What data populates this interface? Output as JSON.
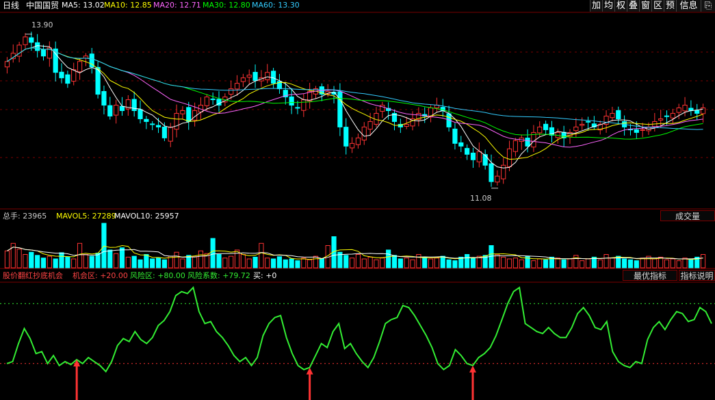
{
  "header": {
    "period": "日线",
    "stock_name": "中国国贸",
    "ma": [
      {
        "label": "MA5: 13.02",
        "color": "#ffffff"
      },
      {
        "label": "MA10: 12.85",
        "color": "#ffff00"
      },
      {
        "label": "MA20: 12.71",
        "color": "#ff66ff"
      },
      {
        "label": "MA30: 12.80",
        "color": "#00ff00"
      },
      {
        "label": "MA60: 13.30",
        "color": "#33ccff"
      }
    ]
  },
  "toolbar": [
    "加",
    "均",
    "权",
    "叠",
    "窗",
    "区",
    "预",
    "信息"
  ],
  "volume_header": {
    "total": "总手: 23965",
    "mavol5": "MAVOL5: 27289",
    "mavol10": "MAVOL10: 25957",
    "button": "成交量"
  },
  "indicator_header": {
    "name": "股价翻红抄底机会",
    "chance": "机会区: +20.00",
    "risk": "风险区: +80.00",
    "coef": "风险系数: +79.72",
    "buy": "买: +0",
    "button_best": "最优指标",
    "button_help": "指标说明"
  },
  "price_labels": {
    "high": "13.90",
    "low": "11.08"
  },
  "colors": {
    "up": "#ff3333",
    "down": "#00ffff",
    "grid": "#7a0000",
    "osc": "#33ee33",
    "signal": "#ff3333"
  },
  "chart_data": [
    {
      "type": "candlestick",
      "title": "日线 中国国贸",
      "ylim": [
        10.7,
        14.3
      ],
      "annotations": [
        {
          "label": "13.90",
          "value": 13.9
        },
        {
          "label": "11.08",
          "value": 11.08
        }
      ],
      "series": [
        {
          "name": "MA5",
          "values": [
            13.02
          ]
        },
        {
          "name": "MA10",
          "values": [
            12.85
          ]
        },
        {
          "name": "MA20",
          "values": [
            12.71
          ]
        },
        {
          "name": "MA30",
          "values": [
            12.8
          ]
        },
        {
          "name": "MA60",
          "values": [
            13.3
          ]
        }
      ],
      "closes": [
        13.4,
        13.55,
        13.7,
        13.85,
        13.75,
        13.6,
        13.5,
        13.65,
        13.2,
        13.1,
        13.0,
        13.25,
        13.4,
        13.5,
        13.3,
        12.8,
        12.6,
        12.4,
        12.6,
        12.5,
        12.7,
        12.5,
        12.35,
        12.3,
        12.25,
        12.2,
        12.0,
        12.2,
        12.45,
        12.5,
        12.3,
        12.5,
        12.6,
        12.75,
        12.7,
        12.6,
        12.75,
        12.9,
        13.0,
        13.1,
        13.15,
        13.05,
        13.1,
        13.2,
        13.0,
        12.9,
        12.75,
        12.6,
        12.55,
        12.7,
        12.85,
        12.9,
        12.8,
        12.85,
        12.8,
        12.2,
        11.85,
        11.9,
        12.0,
        12.2,
        12.3,
        12.45,
        12.6,
        12.5,
        12.3,
        12.2,
        12.25,
        12.35,
        12.45,
        12.4,
        12.55,
        12.6,
        12.5,
        12.2,
        11.9,
        11.85,
        11.7,
        11.6,
        11.75,
        11.5,
        11.2,
        11.3,
        11.5,
        11.8,
        11.95,
        12.0,
        11.85,
        12.1,
        12.2,
        12.15,
        12.05,
        12.1,
        12.0,
        12.1,
        12.2,
        12.25,
        12.3,
        12.2,
        12.25,
        12.4,
        12.45,
        12.35,
        12.2,
        12.15,
        12.1,
        12.15,
        12.2,
        12.3,
        12.35,
        12.4,
        12.45,
        12.55,
        12.6,
        12.5,
        12.45,
        12.55
      ]
    },
    {
      "type": "bar",
      "title": "总手",
      "series": [
        {
          "name": "MAVOL5",
          "values": [
            27289
          ]
        },
        {
          "name": "MAVOL10",
          "values": [
            25957
          ]
        }
      ],
      "values": [
        0.38,
        0.55,
        0.42,
        0.3,
        0.35,
        0.28,
        0.22,
        0.26,
        0.2,
        0.34,
        0.24,
        0.2,
        0.55,
        0.3,
        0.26,
        0.33,
        1.0,
        0.4,
        0.32,
        0.45,
        0.24,
        0.26,
        0.18,
        0.3,
        0.2,
        0.22,
        0.18,
        0.26,
        0.35,
        0.2,
        0.28,
        0.25,
        0.38,
        0.32,
        0.66,
        0.3,
        0.22,
        0.26,
        0.4,
        0.3,
        0.2,
        0.24,
        0.55,
        0.22,
        0.2,
        0.25,
        0.18,
        0.2,
        0.16,
        0.22,
        0.18,
        0.26,
        0.2,
        0.5,
        0.7,
        0.35,
        0.28,
        0.22,
        0.3,
        0.2,
        0.24,
        0.18,
        0.22,
        0.4,
        0.28,
        0.2,
        0.22,
        0.18,
        0.3,
        0.24,
        0.2,
        0.22,
        0.26,
        0.18,
        0.16,
        0.24,
        0.3,
        0.22,
        0.26,
        0.28,
        0.5,
        0.3,
        0.24,
        0.2,
        0.22,
        0.18,
        0.26,
        0.16,
        0.2,
        0.18,
        0.24,
        0.22,
        0.18,
        0.2,
        0.28,
        0.16,
        0.2,
        0.24,
        0.18,
        0.3,
        0.22,
        0.26,
        0.2,
        0.18,
        0.16,
        0.22,
        0.26,
        0.2,
        0.24,
        0.18,
        0.2,
        0.16,
        0.22,
        0.18,
        0.24,
        0.3
      ]
    },
    {
      "type": "line",
      "title": "股价翻红抄底机会",
      "ylim": [
        0,
        100
      ],
      "series": [
        {
          "name": "风险系数",
          "values": [
            20,
            22,
            40,
            55,
            45,
            30,
            32,
            20,
            28,
            18,
            22,
            19,
            24,
            20,
            26,
            22,
            18,
            12,
            22,
            38,
            45,
            42,
            52,
            44,
            40,
            46,
            58,
            63,
            72,
            88,
            92,
            90,
            96,
            72,
            60,
            62,
            52,
            46,
            38,
            28,
            22,
            26,
            18,
            26,
            48,
            60,
            66,
            68,
            46,
            30,
            18,
            14,
            16,
            28,
            40,
            36,
            52,
            60,
            35,
            40,
            30,
            22,
            16,
            26,
            42,
            60,
            64,
            66,
            78,
            76,
            68,
            58,
            48,
            36,
            20,
            14,
            18,
            34,
            28,
            20,
            18,
            26,
            30,
            36,
            48,
            64,
            80,
            92,
            96,
            60,
            56,
            52,
            50,
            56,
            50,
            46,
            46,
            56,
            70,
            76,
            68,
            56,
            54,
            62,
            32,
            22,
            18,
            16,
            22,
            20,
            44,
            56,
            62,
            54,
            64,
            72,
            70,
            62,
            64,
            76,
            72,
            60
          ]
        }
      ],
      "markers": [
        {
          "label": "买",
          "index": 12
        },
        {
          "label": "买",
          "index": 52
        },
        {
          "label": "买",
          "index": 80
        }
      ],
      "reference_lines": [
        20,
        80
      ]
    }
  ]
}
